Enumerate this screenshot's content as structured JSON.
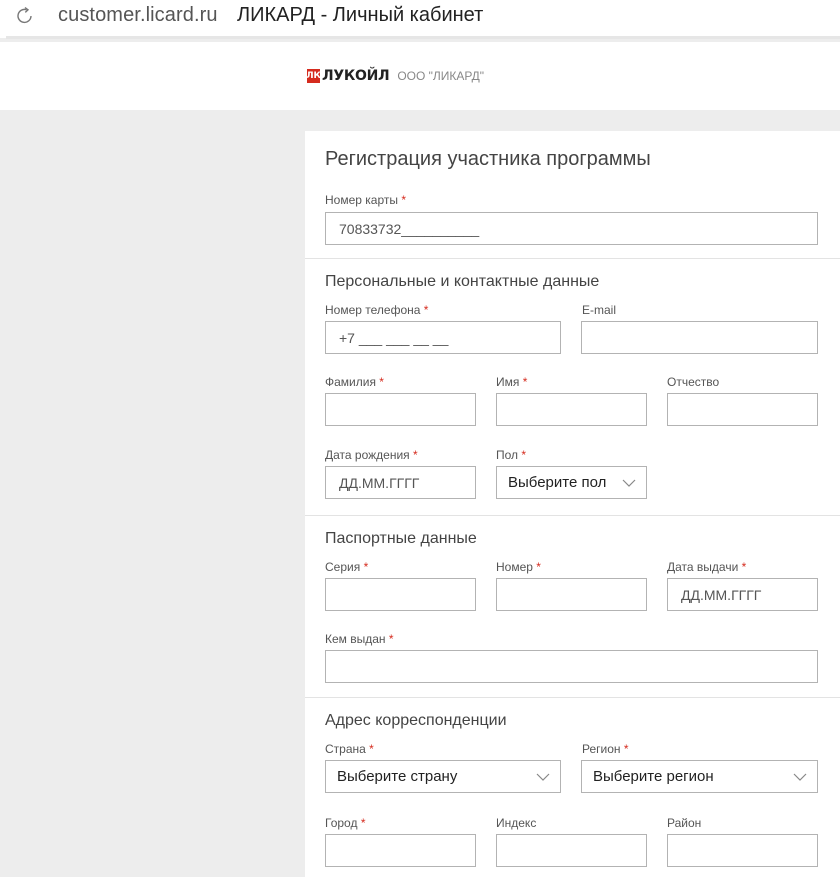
{
  "browser": {
    "url": "customer.licard.ru",
    "title": "ЛИКАРД - Личный кабинет"
  },
  "header": {
    "logo_mark": "ЛК",
    "logo_name": "ЛУКОЙЛ",
    "company": "ООО \"ЛИКАРД\""
  },
  "form": {
    "title": "Регистрация участника программы",
    "card_number": {
      "label": "Номер карты",
      "value": "70833732__________"
    },
    "personal": {
      "title": "Персональные и контактные данные",
      "phone": {
        "label": "Номер телефона",
        "value": "+7 ___ ___ __ __"
      },
      "email": {
        "label": "E-mail",
        "value": ""
      },
      "surname": {
        "label": "Фамилия",
        "value": ""
      },
      "name": {
        "label": "Имя",
        "value": ""
      },
      "patronymic": {
        "label": "Отчество",
        "value": ""
      },
      "birthdate": {
        "label": "Дата рождения",
        "placeholder": "ДД.ММ.ГГГГ"
      },
      "gender": {
        "label": "Пол",
        "selected": "Выберите пол"
      }
    },
    "passport": {
      "title": "Паспортные данные",
      "series": {
        "label": "Серия",
        "value": ""
      },
      "number": {
        "label": "Номер",
        "value": ""
      },
      "issue_date": {
        "label": "Дата выдачи",
        "placeholder": "ДД.ММ.ГГГГ"
      },
      "issued_by": {
        "label": "Кем выдан",
        "value": ""
      }
    },
    "address": {
      "title": "Адрес корреспонденции",
      "country": {
        "label": "Страна",
        "selected": "Выберите страну"
      },
      "region": {
        "label": "Регион",
        "selected": "Выберите регион"
      },
      "city": {
        "label": "Город",
        "value": ""
      },
      "index": {
        "label": "Индекс",
        "value": ""
      },
      "district": {
        "label": "Район",
        "value": ""
      }
    },
    "required_mark": "*"
  },
  "colors": {
    "accent": "#d52b1e",
    "border": "#b3b3b3",
    "background": "#ededed"
  }
}
